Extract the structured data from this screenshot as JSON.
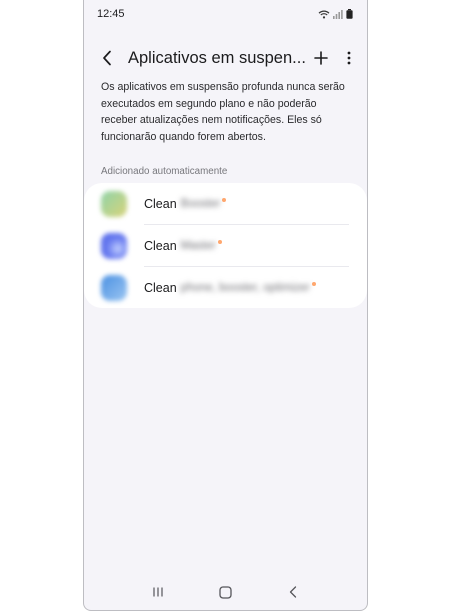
{
  "status_bar": {
    "time": "12:45",
    "icons": [
      "wifi-icon",
      "signal-icon",
      "battery-icon"
    ]
  },
  "app_bar": {
    "title": "Aplicativos em suspen...",
    "icons": [
      "back-arrow-icon",
      "plus-icon",
      "more-vert-icon"
    ]
  },
  "description": "Os aplicativos em suspensão profunda nunca serão executados em segundo plano e não poderão receber atualizações nem notificações. Eles só funcionarão quando forem abertos.",
  "section": {
    "header": "Adicionado automaticamente",
    "items": [
      {
        "label": "Clean",
        "suffix": "Booster",
        "icon_colors": [
          "#8fd3a8",
          "#d8d37a"
        ]
      },
      {
        "label": "Clean",
        "suffix": "Master",
        "icon_colors": [
          "#4e63e6",
          "#c2d0ff"
        ]
      },
      {
        "label": "Clean",
        "suffix": "phone, booster, optimizer",
        "icon_colors": [
          "#4a90e2",
          "#9cc6f2"
        ]
      }
    ]
  },
  "nav_bar": {
    "icons": [
      "recents-icon",
      "home-icon",
      "back-icon"
    ]
  },
  "colors": {
    "background": "#f5f4f9",
    "card": "#ffffff",
    "badge": "#ff8a3d"
  }
}
